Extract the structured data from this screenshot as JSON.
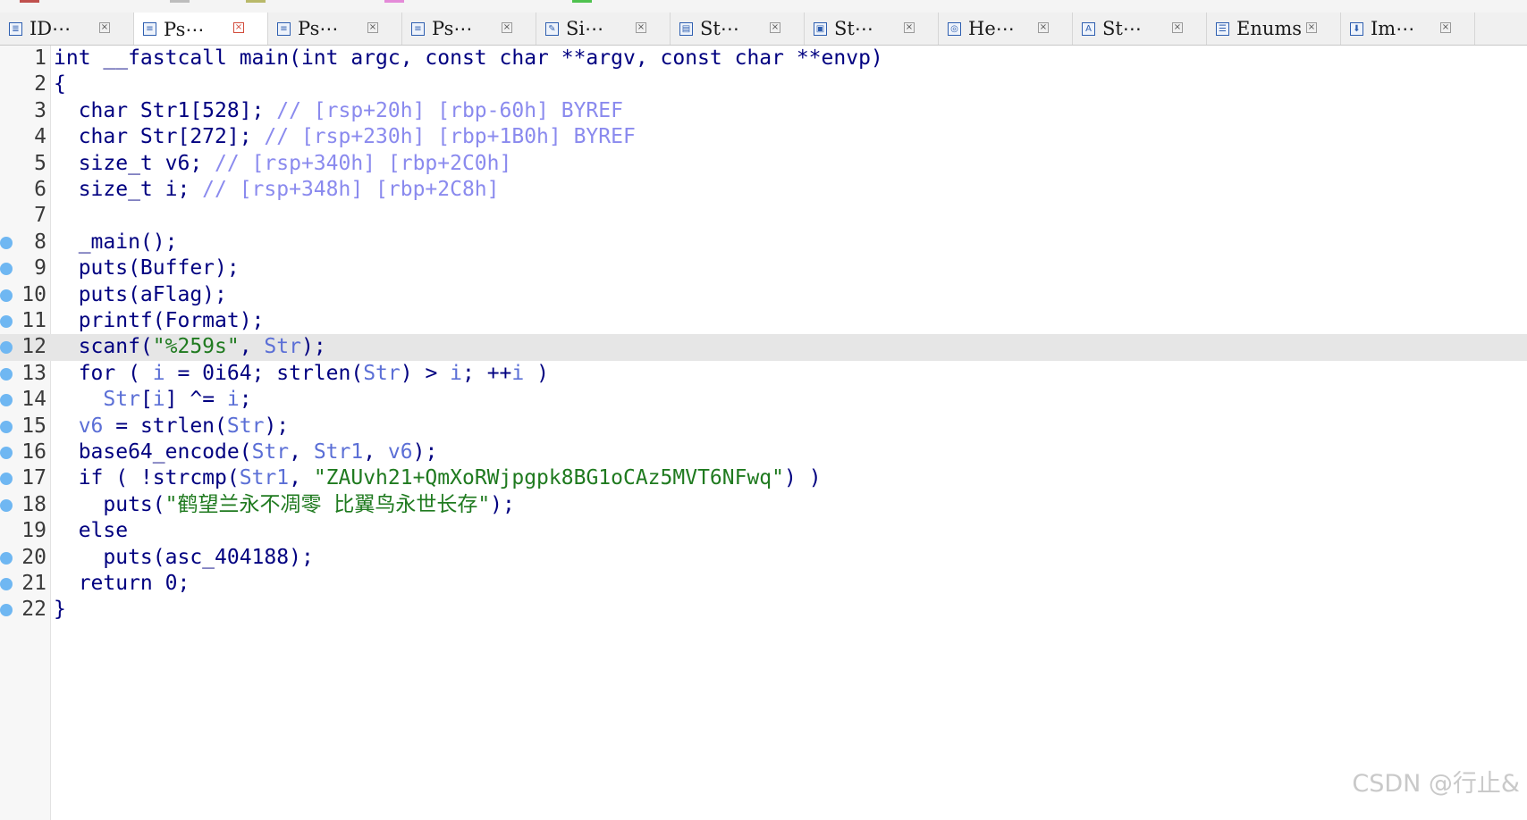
{
  "tabs": [
    {
      "label": "ID⋯",
      "icon": "document-icon"
    },
    {
      "label": "Ps⋯",
      "icon": "pseudocode-icon",
      "active": true
    },
    {
      "label": "Ps⋯",
      "icon": "pseudocode-icon"
    },
    {
      "label": "Ps⋯",
      "icon": "pseudocode-icon"
    },
    {
      "label": "Si⋯",
      "icon": "signature-icon"
    },
    {
      "label": "St⋯",
      "icon": "struct-icon"
    },
    {
      "label": "St⋯",
      "icon": "stack-icon"
    },
    {
      "label": "He⋯",
      "icon": "hex-icon"
    },
    {
      "label": "St⋯",
      "icon": "strings-icon"
    },
    {
      "label": "Enums",
      "icon": "enums-icon"
    },
    {
      "label": "Im⋯",
      "icon": "imports-icon"
    }
  ],
  "code": {
    "current_line": 12,
    "lines": [
      {
        "n": "1",
        "bp": false,
        "tokens": [
          [
            "kw",
            "int __fastcall main(int argc, const char **argv, const char **envp)"
          ]
        ]
      },
      {
        "n": "2",
        "bp": false,
        "tokens": [
          [
            "kw",
            "{"
          ]
        ]
      },
      {
        "n": "3",
        "bp": false,
        "tokens": [
          [
            "kw",
            "  char Str1[528]; "
          ],
          [
            "cmt",
            "// [rsp+20h] [rbp-60h] BYREF"
          ]
        ]
      },
      {
        "n": "4",
        "bp": false,
        "tokens": [
          [
            "kw",
            "  char Str[272]; "
          ],
          [
            "cmt",
            "// [rsp+230h] [rbp+1B0h] BYREF"
          ]
        ]
      },
      {
        "n": "5",
        "bp": false,
        "tokens": [
          [
            "kw",
            "  size_t v6; "
          ],
          [
            "cmt",
            "// [rsp+340h] [rbp+2C0h]"
          ]
        ]
      },
      {
        "n": "6",
        "bp": false,
        "tokens": [
          [
            "kw",
            "  size_t i; "
          ],
          [
            "cmt",
            "// [rsp+348h] [rbp+2C8h]"
          ]
        ]
      },
      {
        "n": "7",
        "bp": false,
        "tokens": [
          [
            "kw",
            " "
          ]
        ]
      },
      {
        "n": "8",
        "bp": true,
        "tokens": [
          [
            "kw",
            "  _main();"
          ]
        ]
      },
      {
        "n": "9",
        "bp": true,
        "tokens": [
          [
            "kw",
            "  puts(Buffer);"
          ]
        ]
      },
      {
        "n": "10",
        "bp": true,
        "tokens": [
          [
            "kw",
            "  puts(aFlag);"
          ]
        ]
      },
      {
        "n": "11",
        "bp": true,
        "tokens": [
          [
            "kw",
            "  printf(Format);"
          ]
        ]
      },
      {
        "n": "12",
        "bp": true,
        "tokens": [
          [
            "kw",
            "  scanf("
          ],
          [
            "str",
            "\"%259s\""
          ],
          [
            "kw",
            ", "
          ],
          [
            "var",
            "Str"
          ],
          [
            "kw",
            ");"
          ]
        ]
      },
      {
        "n": "13",
        "bp": true,
        "tokens": [
          [
            "kw",
            "  for ( "
          ],
          [
            "var",
            "i"
          ],
          [
            "kw",
            " = 0i64; strlen("
          ],
          [
            "var",
            "Str"
          ],
          [
            "kw",
            ") > "
          ],
          [
            "var",
            "i"
          ],
          [
            "kw",
            "; ++"
          ],
          [
            "var",
            "i"
          ],
          [
            "kw",
            " )"
          ]
        ]
      },
      {
        "n": "14",
        "bp": true,
        "tokens": [
          [
            "kw",
            "    "
          ],
          [
            "var",
            "Str"
          ],
          [
            "kw",
            "["
          ],
          [
            "var",
            "i"
          ],
          [
            "kw",
            "] ^= "
          ],
          [
            "var",
            "i"
          ],
          [
            "kw",
            ";"
          ]
        ]
      },
      {
        "n": "15",
        "bp": true,
        "tokens": [
          [
            "kw",
            "  "
          ],
          [
            "var",
            "v6"
          ],
          [
            "kw",
            " = strlen("
          ],
          [
            "var",
            "Str"
          ],
          [
            "kw",
            ");"
          ]
        ]
      },
      {
        "n": "16",
        "bp": true,
        "tokens": [
          [
            "kw",
            "  base64_encode("
          ],
          [
            "var",
            "Str"
          ],
          [
            "kw",
            ", "
          ],
          [
            "var",
            "Str1"
          ],
          [
            "kw",
            ", "
          ],
          [
            "var",
            "v6"
          ],
          [
            "kw",
            ");"
          ]
        ]
      },
      {
        "n": "17",
        "bp": true,
        "tokens": [
          [
            "kw",
            "  if ( !strcmp("
          ],
          [
            "var",
            "Str1"
          ],
          [
            "kw",
            ", "
          ],
          [
            "str",
            "\"ZAUvh21+QmXoRWjpgpk8BG1oCAz5MVT6NFwq\""
          ],
          [
            "kw",
            ") )"
          ]
        ]
      },
      {
        "n": "18",
        "bp": true,
        "tokens": [
          [
            "kw",
            "    puts("
          ],
          [
            "str",
            "\"鹤望兰永不凋零 比翼鸟永世长存\""
          ],
          [
            "kw",
            ");"
          ]
        ]
      },
      {
        "n": "19",
        "bp": false,
        "tokens": [
          [
            "kw",
            "  else"
          ]
        ]
      },
      {
        "n": "20",
        "bp": true,
        "tokens": [
          [
            "kw",
            "    puts(asc_404188);"
          ]
        ]
      },
      {
        "n": "21",
        "bp": true,
        "tokens": [
          [
            "kw",
            "  return 0;"
          ]
        ]
      },
      {
        "n": "22",
        "bp": true,
        "tokens": [
          [
            "kw",
            "}"
          ]
        ]
      }
    ]
  },
  "watermark": "CSDN @行止&",
  "colors": {
    "keyword": "#000080",
    "variable": "#5b6fd6",
    "comment": "#8a8aee",
    "string": "#1f7a1f",
    "breakpoint": "#6fb7f2",
    "current_line_bg": "#e6e6e6"
  }
}
